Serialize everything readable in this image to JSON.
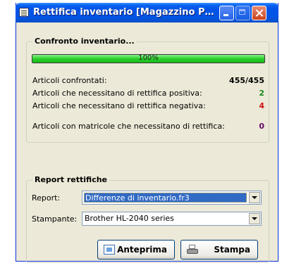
{
  "window": {
    "title": "Rettifica inventario  [Magazzino P…"
  },
  "comparison": {
    "group_title": "Confronto inventario...",
    "progress_percent": 100,
    "progress_label": "100%",
    "rows": [
      {
        "label": "Articoli confrontati:",
        "value": "455/455",
        "color": "#000000"
      },
      {
        "label": "Articoli che necessitano di rettifica positiva:",
        "value": "2",
        "color": "#1a8a1a"
      },
      {
        "label": "Articoli che necessitano di rettifica negativa:",
        "value": "4",
        "color": "#d01010"
      },
      {
        "label": "Articoli con matricole che necessitano di rettifica:",
        "value": "0",
        "color": "#6a0a6a"
      }
    ]
  },
  "report": {
    "group_title": "Report rettifiche",
    "report_label": "Report:",
    "report_value": "Differenze di inventario.fr3",
    "printer_label": "Stampante:",
    "printer_value": "Brother HL-2040 series",
    "preview_button": "Anteprima",
    "print_button": "Stampa"
  },
  "icons": {
    "app": "document-list-icon",
    "preview": "preview-icon",
    "print": "printer-icon"
  }
}
